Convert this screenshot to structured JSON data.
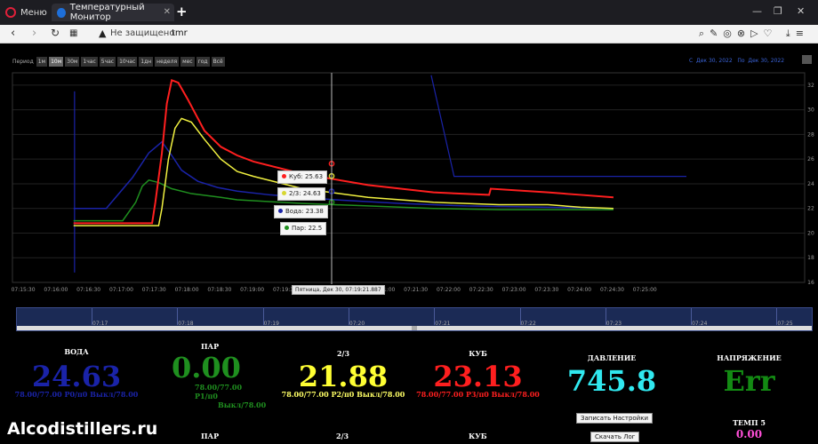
{
  "browser": {
    "menu_label": "Меню",
    "tab_title": "Температурный Монитор",
    "not_secure": "Не защищено",
    "url": "tmr"
  },
  "period": {
    "label": "Период",
    "buttons": [
      "1м",
      "10м",
      "30м",
      "1час",
      "5час",
      "10час",
      "1дн",
      "неделя",
      "мес",
      "год",
      "Всё"
    ],
    "selected": "10м"
  },
  "date_range": {
    "from_label": "С",
    "from": "Дек 30, 2022",
    "to_label": "По",
    "to": "Дек 30, 2022"
  },
  "tooltips": {
    "kub": "Куб: 25.63",
    "two_thirds": "2/3: 24.63",
    "voda": "Вода: 23.38",
    "par": "Пар: 22.5",
    "crosshair": "Пятница, Дек 30, 07:19:21.887"
  },
  "colors": {
    "kub": "#ff1f1f",
    "two_thirds": "#f0f040",
    "voda": "#1a23a8",
    "par": "#1f8f1f",
    "pressure": "#30e8ef",
    "voltage": "#138a13",
    "temp5": "#ff4fd8"
  },
  "chart_data": {
    "type": "line",
    "x_tick_labels": [
      "07:15:30",
      "07:16:00",
      "07:16:30",
      "07:17:00",
      "07:17:30",
      "07:18:00",
      "07:18:30",
      "07:19:00",
      "07:19:30",
      "07:20:00",
      "07:20:30",
      "07:21:00",
      "07:21:30",
      "07:22:00",
      "07:22:30",
      "07:23:00",
      "07:23:30",
      "07:24:00",
      "07:24:30",
      "07:25:00"
    ],
    "y_tick_labels": [
      "16",
      "18",
      "20",
      "22",
      "24",
      "26",
      "28",
      "30",
      "32"
    ],
    "ylim": [
      16,
      33
    ],
    "series": [
      {
        "name": "Куб",
        "color": "#ff1f1f",
        "points": [
          [
            0,
            20.8
          ],
          [
            2.4,
            20.8
          ],
          [
            2.5,
            22.5
          ],
          [
            2.7,
            26.5
          ],
          [
            2.85,
            30.5
          ],
          [
            3.0,
            32.4
          ],
          [
            3.2,
            32.2
          ],
          [
            3.5,
            30.8
          ],
          [
            4.0,
            28.3
          ],
          [
            4.5,
            27.0
          ],
          [
            5.0,
            26.3
          ],
          [
            5.5,
            25.8
          ],
          [
            7.0,
            24.8
          ],
          [
            9.0,
            23.9
          ],
          [
            11.0,
            23.3
          ],
          [
            12.7,
            23.1
          ],
          [
            12.75,
            23.6
          ],
          [
            14.5,
            23.3
          ],
          [
            15.5,
            23.1
          ],
          [
            16.5,
            22.9
          ]
        ]
      },
      {
        "name": "2/3",
        "color": "#f0f040",
        "points": [
          [
            0,
            20.6
          ],
          [
            2.6,
            20.6
          ],
          [
            2.7,
            22.0
          ],
          [
            2.9,
            26.0
          ],
          [
            3.1,
            28.5
          ],
          [
            3.3,
            29.3
          ],
          [
            3.6,
            29.0
          ],
          [
            4.0,
            27.6
          ],
          [
            4.5,
            26.0
          ],
          [
            5.0,
            25.0
          ],
          [
            5.5,
            24.6
          ],
          [
            7.0,
            23.6
          ],
          [
            9.0,
            22.9
          ],
          [
            11.0,
            22.5
          ],
          [
            13.0,
            22.3
          ],
          [
            14.5,
            22.3
          ],
          [
            15.5,
            22.1
          ],
          [
            16.5,
            22.0
          ]
        ]
      },
      {
        "name": "Вода",
        "color": "#1a23a8",
        "points": [
          [
            0,
            22.0
          ],
          [
            1.0,
            22.0
          ],
          [
            1.8,
            24.5
          ],
          [
            2.3,
            26.5
          ],
          [
            2.7,
            27.4
          ],
          [
            3.0,
            26.3
          ],
          [
            3.3,
            25.1
          ],
          [
            3.8,
            24.2
          ],
          [
            4.4,
            23.7
          ],
          [
            5.0,
            23.4
          ],
          [
            6.0,
            23.1
          ],
          [
            8.0,
            22.7
          ],
          [
            10.0,
            22.4
          ],
          [
            12.0,
            22.2
          ],
          [
            14.5,
            22.1
          ],
          [
            16.5,
            22.0
          ]
        ]
      },
      {
        "name": "Пар",
        "color": "#1f8f1f",
        "points": [
          [
            0,
            21.0
          ],
          [
            1.5,
            21.0
          ],
          [
            1.9,
            22.5
          ],
          [
            2.1,
            23.8
          ],
          [
            2.3,
            24.3
          ],
          [
            2.6,
            24.1
          ],
          [
            3.0,
            23.6
          ],
          [
            3.6,
            23.2
          ],
          [
            4.5,
            22.9
          ],
          [
            5.0,
            22.7
          ],
          [
            7.0,
            22.4
          ],
          [
            9.0,
            22.2
          ],
          [
            11.0,
            22.0
          ],
          [
            13.0,
            21.9
          ],
          [
            16.5,
            21.9
          ]
        ]
      }
    ]
  },
  "navigator_ticks": [
    "07:17",
    "07:18",
    "07:19",
    "07:20",
    "07:21",
    "07:22",
    "07:23",
    "07:24",
    "07:25"
  ],
  "panels": {
    "voda": {
      "title": "ВОДА",
      "value": "24.63",
      "sub": "78.00/77.00 P0/п0 Выкл/78.00"
    },
    "par": {
      "title": "ПАР",
      "value": "0.00",
      "sub1": "78.00/77.00 P1/п0",
      "sub2": "Выкл/78.00"
    },
    "two_thirds": {
      "title": "2/3",
      "value": "21.88",
      "sub": "78.00/77.00 P2/п0 Выкл/78.00"
    },
    "kub": {
      "title": "КУБ",
      "value": "23.13",
      "sub": "78.00/77.00 P3/п0 Выкл/78.00"
    },
    "pressure": {
      "title": "ДАВЛЕНИЕ",
      "value": "745.8"
    },
    "voltage": {
      "title": "НАПРЯЖЕНИЕ",
      "value": "Err"
    },
    "temp5": {
      "title": "ТЕМП 5",
      "value": "0.00"
    }
  },
  "buttons": {
    "save_settings": "Записать Настройки",
    "download_log": "Скачать Лог"
  },
  "bottom_titles": {
    "par": "ПАР",
    "two_thirds": "2/3",
    "kub": "КУБ"
  },
  "watermark": "Alcodistillers.ru"
}
